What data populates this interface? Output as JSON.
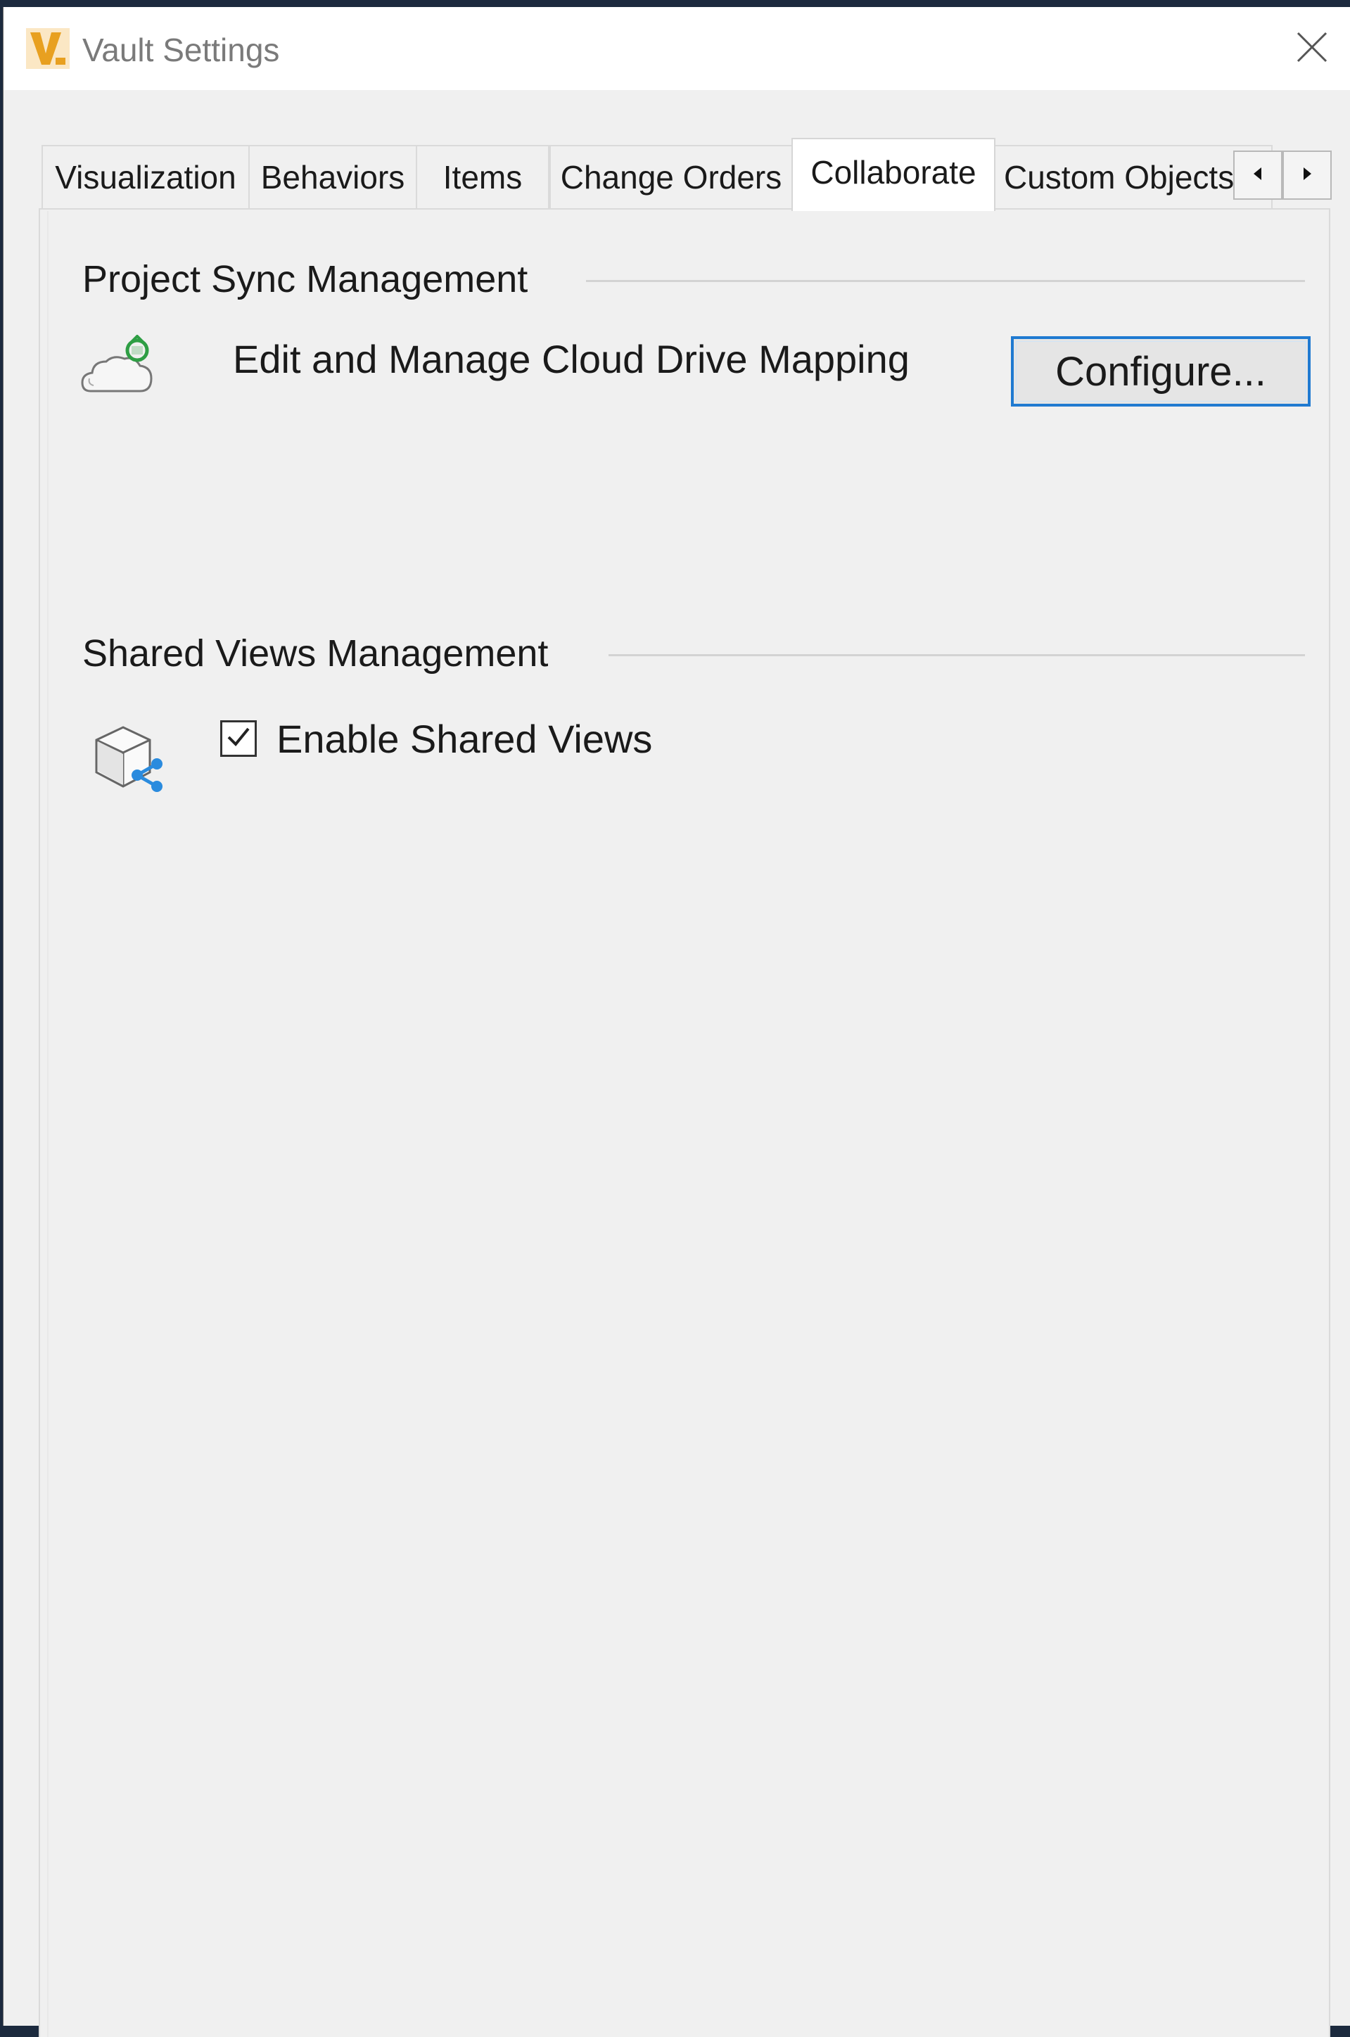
{
  "window": {
    "title": "Vault Settings",
    "app_icon": "vault-app-icon",
    "close_icon": "close-icon"
  },
  "tabs": [
    {
      "label": "Visualization",
      "active": false
    },
    {
      "label": "Behaviors",
      "active": false
    },
    {
      "label": "Items",
      "active": false
    },
    {
      "label": "Change Orders",
      "active": false
    },
    {
      "label": "Collaborate",
      "active": true
    },
    {
      "label": "Custom Objects",
      "active": false
    }
  ],
  "tab_scroll": {
    "left_icon": "triangle-left-icon",
    "right_icon": "triangle-right-icon"
  },
  "project_sync": {
    "title": "Project Sync Management",
    "icon": "cloud-sync-icon",
    "label": "Edit and Manage Cloud Drive Mapping",
    "button_label": "Configure..."
  },
  "shared_views": {
    "title": "Shared Views Management",
    "icon": "shared-views-cube-icon",
    "checkbox_label": "Enable Shared Views",
    "checked": true
  },
  "colors": {
    "accent": "#1f7ad1",
    "brand": "#f5a623",
    "background": "#f0f0f0"
  }
}
